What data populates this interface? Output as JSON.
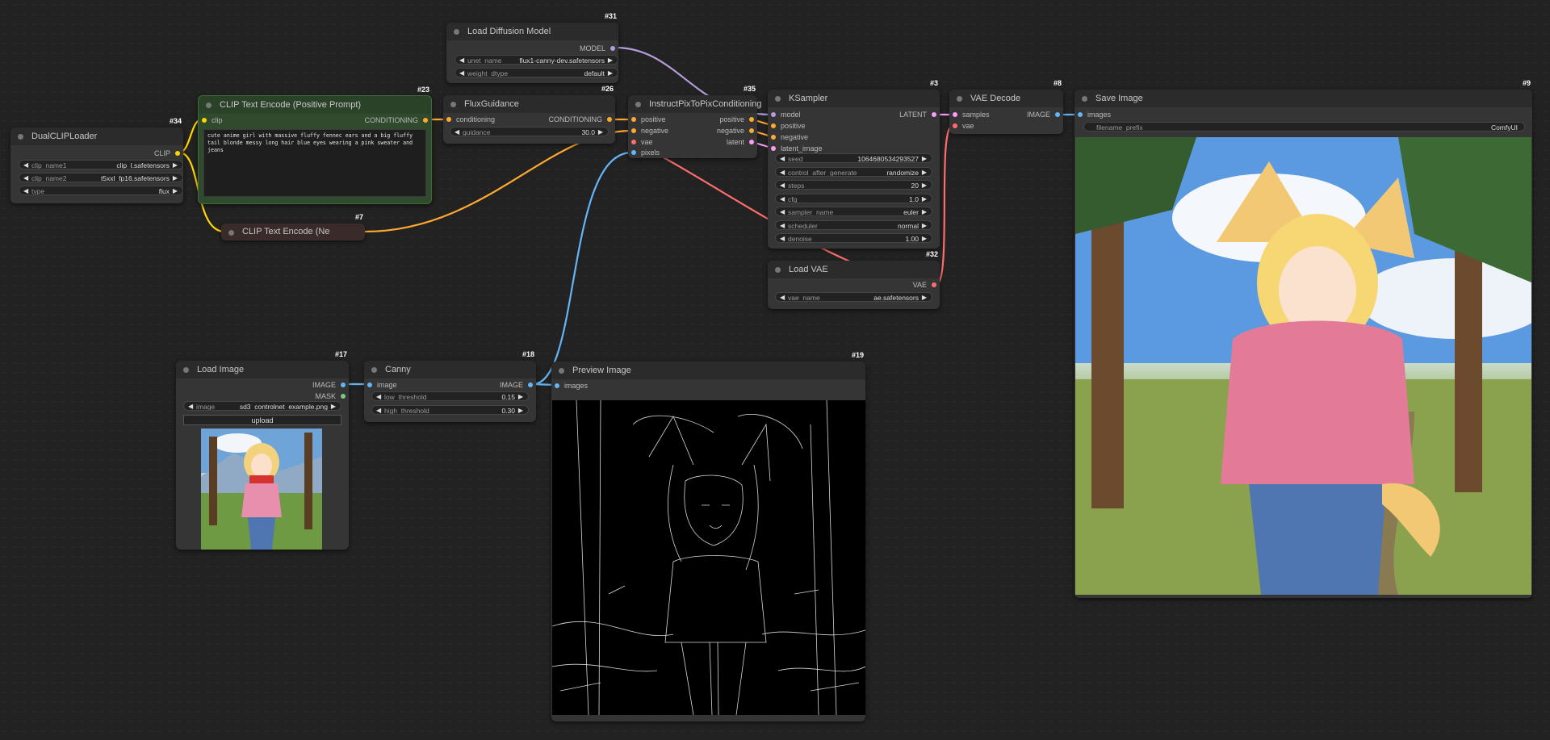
{
  "colors": {
    "clip": "#ffd500",
    "conditioning": "#ffa931",
    "model": "#b39ddb",
    "vae": "#ff6e6e",
    "image": "#64b5f6",
    "latent": "#ff9cf9",
    "mask": "#81c784"
  },
  "nodes": {
    "dual_clip_loader": {
      "id": "#34",
      "title": "DualCLIPLoader",
      "out_clip": "CLIP",
      "clip_name1_label": "clip_name1",
      "clip_name1": "clip_l.safetensors",
      "clip_name2_label": "clip_name2",
      "clip_name2": "t5xxl_fp16.safetensors",
      "type_label": "type",
      "type": "flux"
    },
    "clip_text_pos": {
      "id": "#23",
      "title": "CLIP Text Encode (Positive Prompt)",
      "in_clip": "clip",
      "out_conditioning": "CONDITIONING",
      "prompt": "cute anime girl with massive fluffy fennec ears and a big fluffy tail blonde messy long hair blue eyes wearing a pink sweater and jeans"
    },
    "clip_text_neg": {
      "id": "#7",
      "title": "CLIP Text Encode (Ne"
    },
    "load_diffusion": {
      "id": "#31",
      "title": "Load Diffusion Model",
      "out_model": "MODEL",
      "unet_name_label": "unet_name",
      "unet_name": "flux1-canny-dev.safetensors",
      "weight_dtype_label": "weight_dtype",
      "weight_dtype": "default"
    },
    "flux_guidance": {
      "id": "#26",
      "title": "FluxGuidance",
      "in_conditioning": "conditioning",
      "out_conditioning": "CONDITIONING",
      "guidance_label": "guidance",
      "guidance": "30.0"
    },
    "instruct_pix": {
      "id": "#35",
      "title": "InstructPixToPixConditioning",
      "in_positive": "positive",
      "in_negative": "negative",
      "in_vae": "vae",
      "in_pixels": "pixels",
      "out_positive": "positive",
      "out_negative": "negative",
      "out_latent": "latent"
    },
    "ksampler": {
      "id": "#3",
      "title": "KSampler",
      "in_model": "model",
      "in_positive": "positive",
      "in_negative": "negative",
      "in_latent": "latent_image",
      "out_latent": "LATENT",
      "seed_label": "seed",
      "seed": "1064680534293527",
      "cag_label": "control_after_generate",
      "cag": "randomize",
      "steps_label": "steps",
      "steps": "20",
      "cfg_label": "cfg",
      "cfg": "1.0",
      "sampler_label": "sampler_name",
      "sampler": "euler",
      "scheduler_label": "scheduler",
      "scheduler": "normal",
      "denoise_label": "denoise",
      "denoise": "1.00"
    },
    "vae_decode": {
      "id": "#8",
      "title": "VAE Decode",
      "in_samples": "samples",
      "in_vae": "vae",
      "out_image": "IMAGE"
    },
    "load_vae": {
      "id": "#32",
      "title": "Load VAE",
      "out_vae": "VAE",
      "vae_name_label": "vae_name",
      "vae_name": "ae.safetensors"
    },
    "save_image": {
      "id": "#9",
      "title": "Save Image",
      "in_images": "images",
      "filename_prefix_label": "filename_prefix",
      "filename_prefix": "ComfyUI"
    },
    "load_image": {
      "id": "#17",
      "title": "Load Image",
      "out_image": "IMAGE",
      "out_mask": "MASK",
      "image_label": "image",
      "image": "sd3_controlnet_example.png",
      "upload": "upload"
    },
    "canny": {
      "id": "#18",
      "title": "Canny",
      "in_image": "image",
      "out_image": "IMAGE",
      "low_label": "low_threshold",
      "low": "0.15",
      "high_label": "high_threshold",
      "high": "0.30"
    },
    "preview_image": {
      "id": "#19",
      "title": "Preview Image",
      "in_images": "images"
    }
  }
}
